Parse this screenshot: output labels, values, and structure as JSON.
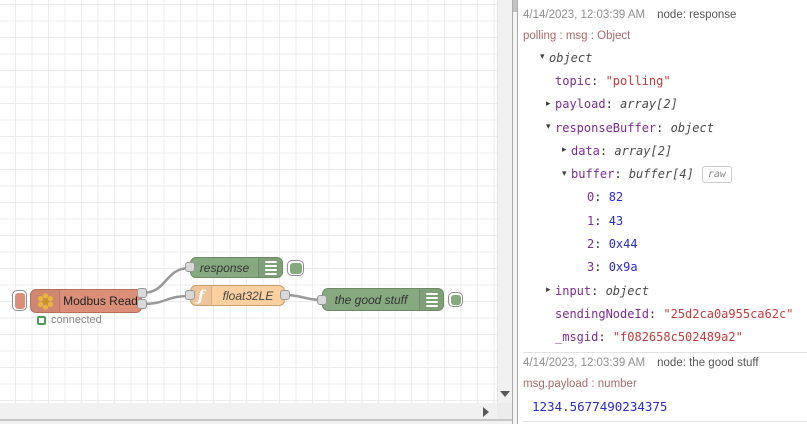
{
  "flow": {
    "nodes": {
      "modbus": {
        "label": "Modbus Read",
        "status": "connected",
        "color": "#DB8F79"
      },
      "response": {
        "label": "response",
        "color": "#87A980"
      },
      "func": {
        "label": "float32LE",
        "icon_glyph": "ƒ",
        "color": "#FDD0A2"
      },
      "good": {
        "label": "the good stuff",
        "color": "#87A980"
      }
    },
    "wire_color": "#999999",
    "status_green": "#4F9D55"
  },
  "debug_panel": {
    "messages": [
      {
        "timestamp": "4/14/2023, 12:03:39 AM",
        "node_label": "node: response",
        "meta": "polling : msg : Object",
        "tree": [
          {
            "indent": 0,
            "arrow": "down",
            "root": "object"
          },
          {
            "indent": 1,
            "arrow": null,
            "key": "topic",
            "value": "\"polling\"",
            "vclass": "string"
          },
          {
            "indent": 1,
            "arrow": "right",
            "key": "payload",
            "value": "array[2]",
            "vclass": "type"
          },
          {
            "indent": 1,
            "arrow": "down",
            "key": "responseBuffer",
            "value": "object",
            "vclass": "type"
          },
          {
            "indent": 2,
            "arrow": "right",
            "key": "data",
            "value": "array[2]",
            "vclass": "type"
          },
          {
            "indent": 2,
            "arrow": "down",
            "key": "buffer",
            "value": "buffer[4]",
            "vclass": "type",
            "badge": "raw"
          },
          {
            "indent": 3,
            "arrow": null,
            "key": "0",
            "value": "82",
            "vclass": "number"
          },
          {
            "indent": 3,
            "arrow": null,
            "key": "1",
            "value": "43",
            "vclass": "number"
          },
          {
            "indent": 3,
            "arrow": null,
            "key": "2",
            "value": "0x44",
            "vclass": "number"
          },
          {
            "indent": 3,
            "arrow": null,
            "key": "3",
            "value": "0x9a",
            "vclass": "number"
          },
          {
            "indent": 1,
            "arrow": "right",
            "key": "input",
            "value": "object",
            "vclass": "type"
          },
          {
            "indent": 1,
            "arrow": null,
            "key": "sendingNodeId",
            "value": "\"25d2ca0a955ca62c\"",
            "vclass": "string"
          },
          {
            "indent": 1,
            "arrow": null,
            "key": "_msgid",
            "value": "\"f082658c502489a2\"",
            "vclass": "string"
          }
        ]
      },
      {
        "timestamp": "4/14/2023, 12:03:39 AM",
        "node_label": "node: the good stuff",
        "meta": "msg.payload : number",
        "payload_value": "1234.5677490234375"
      }
    ],
    "colors": {
      "key": "#7c2d95",
      "number": "#2a2ad4",
      "string": "#c23b3b",
      "type": "#4a4a4a",
      "meta": "#a96a6a",
      "timestamp": "#909090"
    }
  }
}
